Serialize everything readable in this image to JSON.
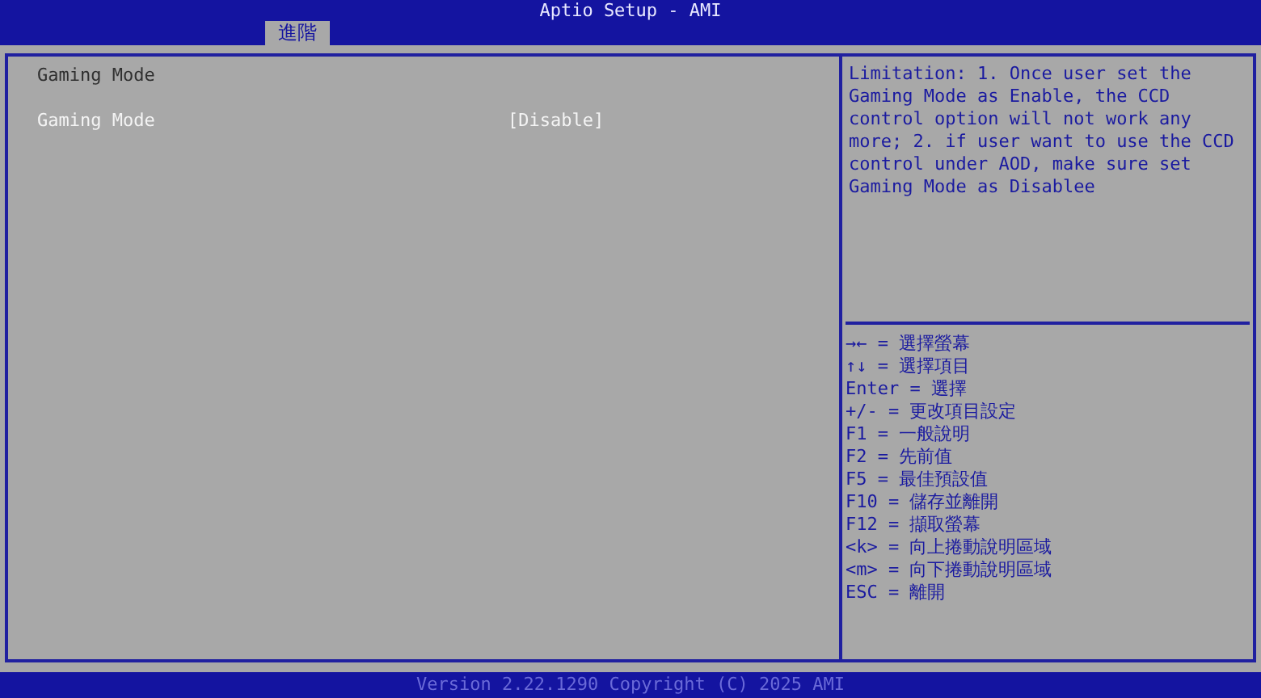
{
  "window": {
    "title": "Aptio Setup - AMI"
  },
  "tabs": [
    {
      "label": "進階",
      "selected": true
    }
  ],
  "page": {
    "title": "Gaming Mode",
    "settings": [
      {
        "label": "Gaming Mode",
        "value": "[Disable]",
        "selected": false
      }
    ]
  },
  "help": {
    "text": "Limitation: 1. Once user set the Gaming Mode as Enable, the CCD control option will not work any more; 2. if user want to use the CCD control under AOD, make sure set Gaming Mode as Disablee",
    "keys": [
      "→← = 選擇螢幕",
      "↑↓ = 選擇項目",
      "Enter = 選擇",
      "+/- = 更改項目設定",
      "F1 = 一般說明",
      "F2 = 先前值",
      "F5 = 最佳預設值",
      "F10 = 儲存並離開",
      "F12 = 擷取螢幕",
      "<k> = 向上捲動說明區域",
      "<m> = 向下捲動說明區域",
      "ESC = 離開"
    ]
  },
  "status_bar": "Version 2.22.1290 Copyright (C) 2025 AMI"
}
